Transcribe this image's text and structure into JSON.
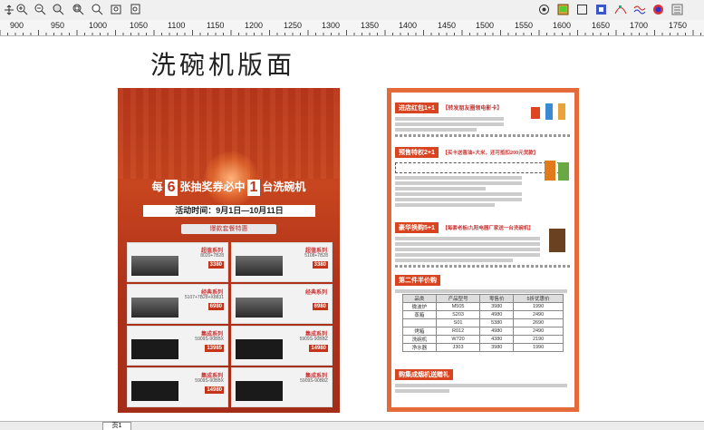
{
  "ruler": {
    "labels": [
      "900",
      "950",
      "1000",
      "1050",
      "1100",
      "1150",
      "1200",
      "1250",
      "1300",
      "1350",
      "1400",
      "1450",
      "1500",
      "1550",
      "1600",
      "1650",
      "1700",
      "1750"
    ]
  },
  "canvas": {
    "title": "洗碗机版面"
  },
  "flyer_left": {
    "headline_prefix": "每",
    "headline_num1": "6",
    "headline_mid": "张抽奖券必中",
    "headline_num2": "1",
    "headline_suffix": "台洗碗机",
    "date_text": "活动时间：9月1日—10月11日",
    "section_label": "爆款套餐特惠",
    "products": [
      {
        "series": "超值系列",
        "model": "8020+7B28",
        "price": "3380"
      },
      {
        "series": "超值系列",
        "model": "5108+7B28",
        "price": "3380"
      },
      {
        "series": "经典系列",
        "model": "5107+7B28+X8831",
        "price": "6980"
      },
      {
        "series": "经典系列",
        "model": "",
        "price": "6980"
      },
      {
        "series": "集成系列",
        "model": "5909S-90BBX",
        "price": "13985"
      },
      {
        "series": "集成系列",
        "model": "5909S-90BBZ",
        "price": "14980"
      },
      {
        "series": "集成系列",
        "model": "5909S-90BBX",
        "price": "14980"
      },
      {
        "series": "集成系列",
        "model": "5909S-90B8Z",
        "price": ""
      }
    ]
  },
  "flyer_right": {
    "sec1_head": "进店红包1+1",
    "sec1_tag": "【转发朋友圈领电影卡】",
    "sec2_head": "预售特权2+1",
    "sec2_tag": "【买卡送香油+大米，还可抵扣200元货款】",
    "sec3_head": "豪华换购5+1",
    "sec3_tag": "【每套老板/九阳电器厂家送一台洗碗机】",
    "sec4_head": "第二件半价购",
    "sec5_head": "购集成烟机送赠礼",
    "table_headers": [
      "品类",
      "产品型号",
      "零售价",
      "5折优惠价"
    ],
    "table_rows": [
      [
        "微波炉",
        "M505",
        "3980",
        "1990"
      ],
      [
        "蒸箱",
        "S203",
        "4980",
        "2490"
      ],
      [
        "",
        "S01",
        "5380",
        "2690"
      ],
      [
        "烤箱",
        "R012",
        "4980",
        "2490"
      ],
      [
        "洗碗机",
        "W720",
        "4380",
        "2190"
      ],
      [
        "净水器",
        "J303",
        "3980",
        "1990"
      ]
    ]
  },
  "status": {
    "page_tab": "页1"
  }
}
